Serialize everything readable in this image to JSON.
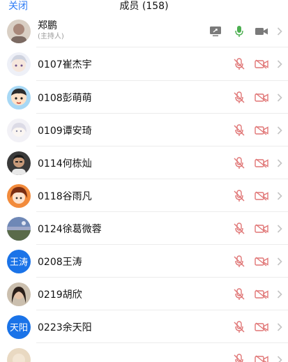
{
  "header": {
    "close_label": "关闭",
    "title": "成员 (158)"
  },
  "host": {
    "name": "郑鹏",
    "subtitle": "(主持人)"
  },
  "members": [
    {
      "name": "0107崔杰宇"
    },
    {
      "name": "0108彭萌萌"
    },
    {
      "name": "0109谭安琦"
    },
    {
      "name": "0114何栋灿"
    },
    {
      "name": "0118谷雨凡"
    },
    {
      "name": "0124徐葛微蓉"
    },
    {
      "name": "0208王涛",
      "avatar_text": "王涛"
    },
    {
      "name": "0219胡欣"
    },
    {
      "name": "0223余天阳",
      "avatar_text": "天阳"
    },
    {
      "name": ""
    }
  ],
  "colors": {
    "accent": "#2f7cf6",
    "muted_icon": "#e07676",
    "host_mic": "#4caf50"
  }
}
